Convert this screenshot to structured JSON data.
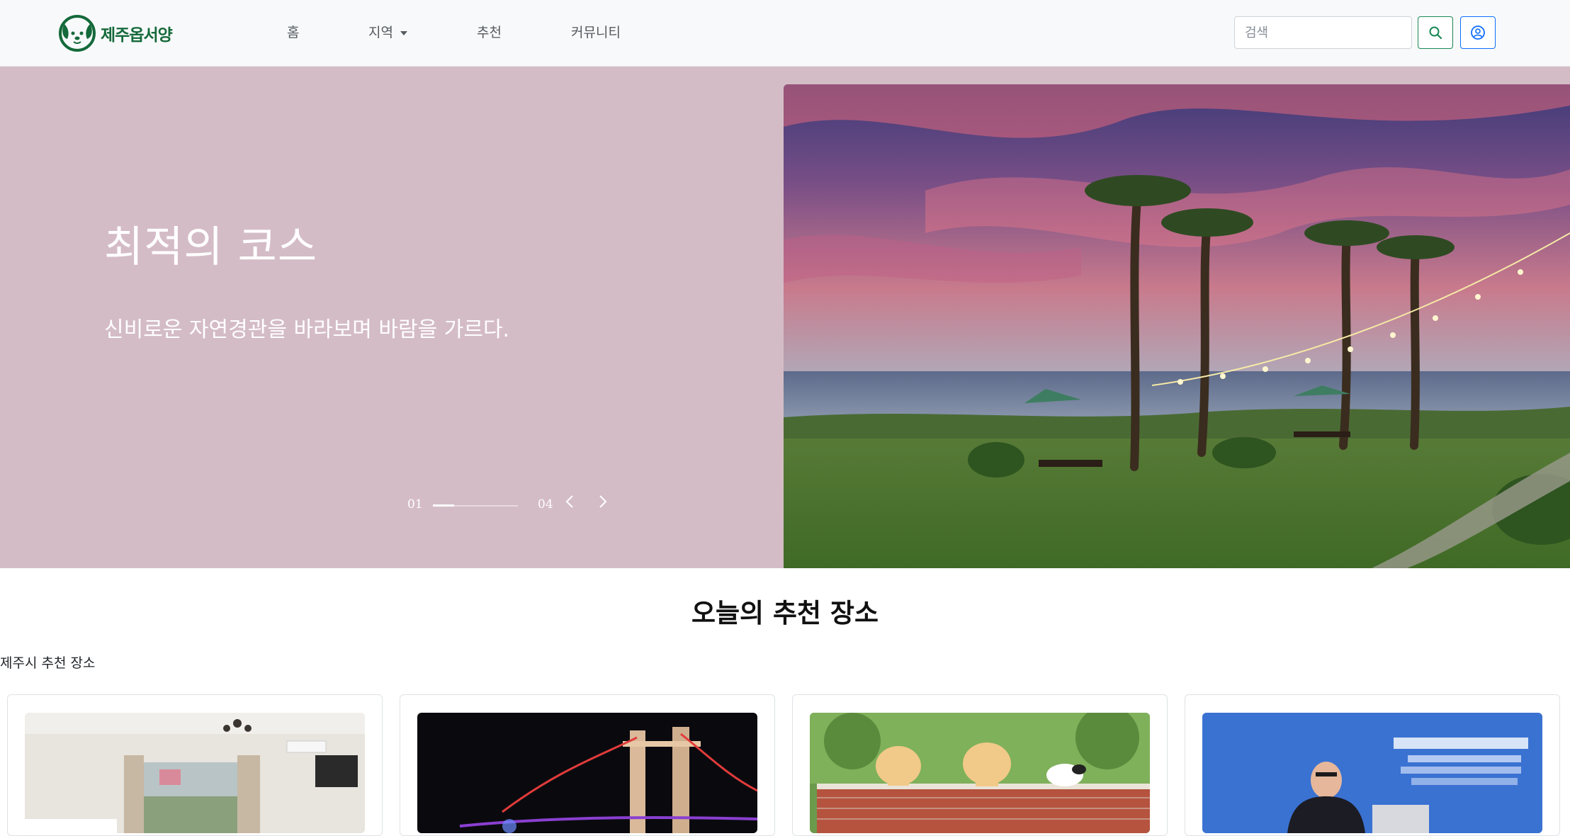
{
  "brand": {
    "name": "제주옵서양",
    "logo_icon": "dog-face-icon",
    "color": "#14693a"
  },
  "nav": {
    "items": [
      {
        "label": "홈"
      },
      {
        "label": "지역",
        "dropdown": true
      },
      {
        "label": "추천"
      },
      {
        "label": "커뮤니티"
      }
    ]
  },
  "search": {
    "placeholder": "검색",
    "value": "",
    "button_icon": "search-icon",
    "button_color": "#198754"
  },
  "user": {
    "button_icon": "user-circle-icon",
    "button_color": "#0d6efd"
  },
  "hero": {
    "title": "최적의 코스",
    "subtitle": "신비로운 자연경관을 바라보며 바람을 가르다.",
    "background_color": "#d4bcc6",
    "slider": {
      "current": "01",
      "total": "04",
      "progress": 0.25,
      "prev_icon": "chevron-left-icon",
      "next_icon": "chevron-right-icon"
    },
    "image": {
      "subject": "palm-trees-ocean-sunset-photo"
    }
  },
  "recommend": {
    "title": "오늘의 추천 장소",
    "subtitle": "제주시 추천 장소",
    "cards": [
      {
        "image": "hotel-room-photo"
      },
      {
        "image": "night-bridge-photo"
      },
      {
        "image": "snoopy-statues-photo"
      },
      {
        "image": "cruise-forum-speaker-photo"
      }
    ]
  }
}
